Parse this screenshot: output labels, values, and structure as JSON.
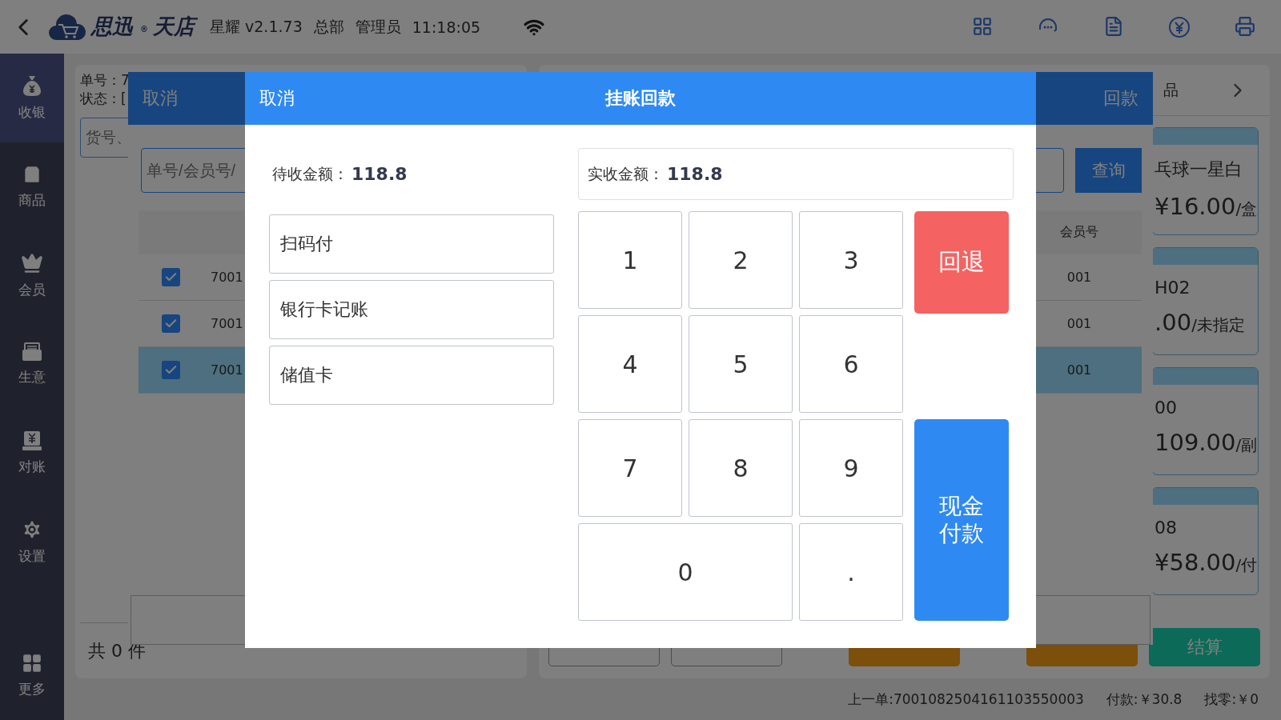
{
  "top_bar": {
    "logo_first": "思迅",
    "logo_mark": "®",
    "logo_second": "天店",
    "version": "星耀 v2.1.73",
    "branch": "总部",
    "user": "管理员",
    "time": "11:18:05"
  },
  "sidebar": {
    "items": [
      {
        "label": "收银",
        "kind": "bag",
        "selected": true
      },
      {
        "label": "商品",
        "kind": "shop",
        "selected": false
      },
      {
        "label": "会员",
        "kind": "crown",
        "selected": false
      },
      {
        "label": "生意",
        "kind": "tray",
        "selected": false
      },
      {
        "label": "对账",
        "kind": "register",
        "selected": false
      },
      {
        "label": "设置",
        "kind": "gear",
        "selected": false
      },
      {
        "label": "更多",
        "kind": "grid",
        "selected": false
      }
    ]
  },
  "order_panel": {
    "order_no": "单号：7",
    "status": "状态：[",
    "search_placeholder": "货号、",
    "count": "共 0 件"
  },
  "goods_panel": {
    "tab": "品",
    "cards": [
      {
        "name": "乓球一星白",
        "price": "¥16.00",
        "unit": "/盒"
      },
      {
        "name": "H02",
        "price": ".00",
        "unit": "/未指定"
      },
      {
        "name": "00",
        "price": "109.00",
        "unit": "/副"
      },
      {
        "name": "08",
        "price": "¥58.00",
        "unit": "/付"
      }
    ],
    "buttons": [
      {
        "kind": "outline"
      },
      {
        "kind": "outline"
      },
      {
        "kind": "orange"
      },
      {
        "kind": "orange"
      },
      {
        "label": "结算",
        "kind": "green"
      }
    ]
  },
  "repay_dialog": {
    "cancel": "取消",
    "confirm": "回款",
    "search_placeholder": "单号/会员号/",
    "query": "查询",
    "member_column": "会员号",
    "rows": [
      {
        "checked": true,
        "selected": false,
        "order": "7001",
        "member": "001"
      },
      {
        "checked": true,
        "selected": false,
        "order": "7001",
        "member": "001"
      },
      {
        "checked": true,
        "selected": true,
        "order": "7001",
        "member": "001"
      }
    ]
  },
  "payment_dialog": {
    "cancel": "取消",
    "title": "挂账回款",
    "due_label": "待收金额：",
    "due": "118.8",
    "received_label": "实收金额：",
    "received": "118.8",
    "methods": [
      "扫码付",
      "银行卡记账",
      "储值卡"
    ],
    "keys": [
      {
        "label": "1",
        "kind": "digit"
      },
      {
        "label": "2",
        "kind": "digit"
      },
      {
        "label": "3",
        "kind": "digit"
      },
      {
        "label": "4",
        "kind": "digit"
      },
      {
        "label": "5",
        "kind": "digit"
      },
      {
        "label": "6",
        "kind": "digit"
      },
      {
        "label": "7",
        "kind": "digit"
      },
      {
        "label": "8",
        "kind": "digit"
      },
      {
        "label": "9",
        "kind": "digit"
      },
      {
        "label": "0",
        "kind": "wide"
      },
      {
        "label": ".",
        "kind": "digit"
      }
    ],
    "back": "回退",
    "cash": "现金付款"
  },
  "status_bar": [
    "上一单:7001082504161103550003",
    "付款:￥30.8",
    "找零:￥0"
  ]
}
